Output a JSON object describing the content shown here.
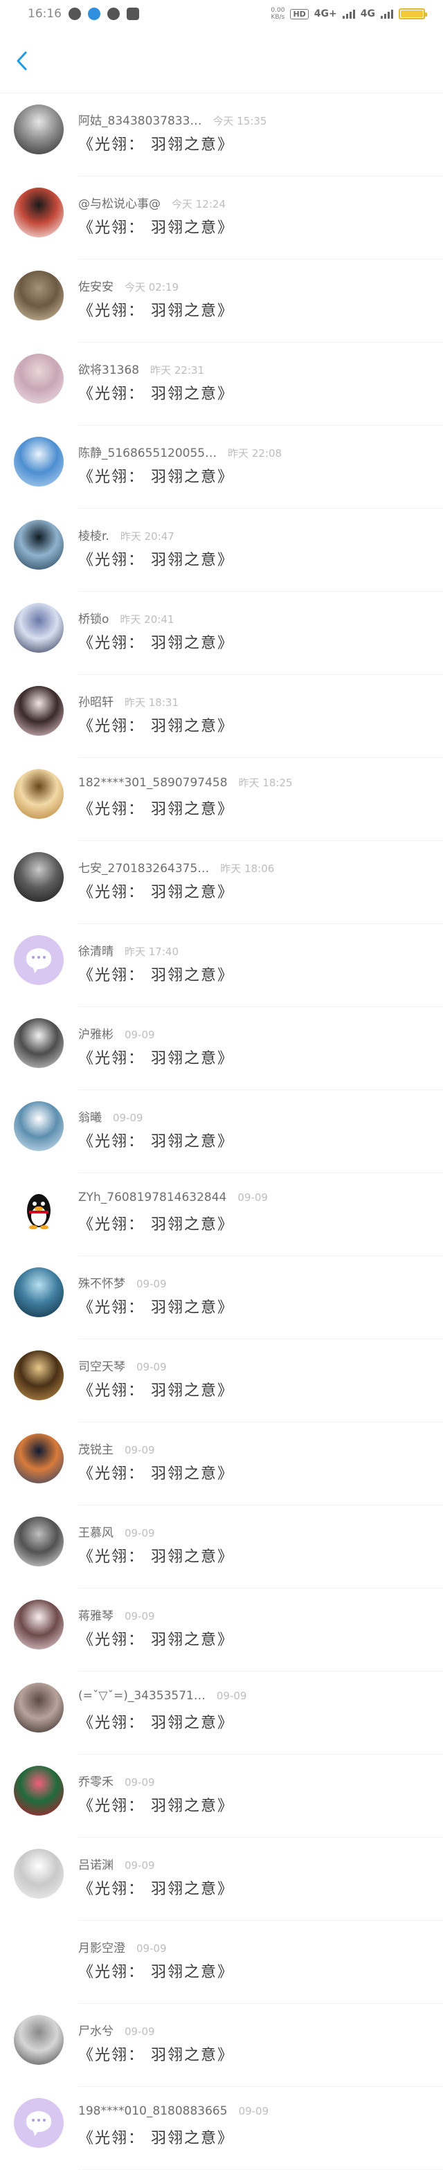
{
  "status_bar": {
    "time": "16:16",
    "speed_value": "0.00",
    "speed_unit": "KB/s",
    "hd_badge": "HD",
    "network_1": "4G+",
    "network_2": "4G"
  },
  "nav": {
    "back_icon": "chevron-left-icon",
    "accent_color": "#1e9be8"
  },
  "rows": [
    {
      "name": "阿姑_83438037833…",
      "time": "今天 15:35",
      "content": "《光翎： 羽翎之意》",
      "avatar_colors": [
        "#2b2b2b",
        "#8c8c8c",
        "#e6e6e6"
      ]
    },
    {
      "name": "@与松说心事@",
      "time": "今天 12:24",
      "content": "《光翎： 羽翎之意》",
      "avatar_colors": [
        "#ffffff",
        "#c44a3a",
        "#1a1a1a"
      ]
    },
    {
      "name": "佐安安",
      "time": "今天 02:19",
      "content": "《光翎： 羽翎之意》",
      "avatar_colors": [
        "#d8c7a8",
        "#6d5a44",
        "#a39376"
      ]
    },
    {
      "name": "欲将31368",
      "time": "昨天 22:31",
      "content": "《光翎： 羽翎之意》",
      "avatar_colors": [
        "#f2e2e8",
        "#c9a7b4",
        "#e8d6da"
      ]
    },
    {
      "name": "陈静_5168655120055…",
      "time": "昨天 22:08",
      "content": "《光翎： 羽翎之意》",
      "avatar_colors": [
        "#bcd9f4",
        "#4d8fd1",
        "#e9f3fb"
      ]
    },
    {
      "name": "棱棱r.",
      "time": "昨天 20:47",
      "content": "《光翎： 羽翎之意》",
      "avatar_colors": [
        "#1d3a50",
        "#8fb2cc",
        "#0e1a24"
      ]
    },
    {
      "name": "桥锁o",
      "time": "昨天 20:41",
      "content": "《光翎： 羽翎之意》",
      "avatar_colors": [
        "#27304f",
        "#d7dff0",
        "#6a78a8"
      ]
    },
    {
      "name": "孙昭轩",
      "time": "昨天 18:31",
      "content": "《光翎： 羽翎之意》",
      "avatar_colors": [
        "#f5d5dc",
        "#3a2a2a",
        "#f0e6e0"
      ]
    },
    {
      "name": "182****301_5890797458",
      "time": "昨天 18:25",
      "content": "《光翎： 羽翎之意》",
      "avatar_colors": [
        "#b07a2e",
        "#f2d9a6",
        "#6b4718"
      ]
    },
    {
      "name": "七安_270183264375…",
      "time": "昨天 18:06",
      "content": "《光翎： 羽翎之意》",
      "avatar_colors": [
        "#141414",
        "#5c5c5c",
        "#c9c9c9"
      ]
    },
    {
      "name": "徐清晴",
      "time": "昨天 17:40",
      "content": "《光翎： 羽翎之意》",
      "avatar_colors": [
        "#d8c7f0",
        "#d8c7f0",
        "#d8c7f0"
      ],
      "default": true
    },
    {
      "name": "沪雅彬",
      "time": "09-09",
      "content": "《光翎： 羽翎之意》",
      "avatar_colors": [
        "#d9d9d9",
        "#4d4d4d",
        "#f0f0f0"
      ]
    },
    {
      "name": "翁曦",
      "time": "09-09",
      "content": "《光翎： 羽翎之意》",
      "avatar_colors": [
        "#dcebf5",
        "#5d8fb0",
        "#ffffff"
      ]
    },
    {
      "name": "ZYh_7608197814632844",
      "time": "09-09",
      "content": "《光翎： 羽翎之意》",
      "avatar_colors": [
        "#ffffff",
        "#111111",
        "#f5a623"
      ],
      "penguin": true
    },
    {
      "name": "殊不怀梦",
      "time": "09-09",
      "content": "《光翎： 羽翎之意》",
      "avatar_colors": [
        "#0e2a3c",
        "#3f7d9e",
        "#b8dff0"
      ]
    },
    {
      "name": "司空天琴",
      "time": "09-09",
      "content": "《光翎： 羽翎之意》",
      "avatar_colors": [
        "#c89a52",
        "#4a3015",
        "#e9c98c"
      ]
    },
    {
      "name": "茂锐主",
      "time": "09-09",
      "content": "《光翎： 羽翎之意》",
      "avatar_colors": [
        "#28406a",
        "#d87b3b",
        "#0f1c33"
      ]
    },
    {
      "name": "王慕风",
      "time": "09-09",
      "content": "《光翎： 羽翎之意》",
      "avatar_colors": [
        "#e7e7e7",
        "#525252",
        "#bfbfbf"
      ]
    },
    {
      "name": "蒋雅琴",
      "time": "09-09",
      "content": "《光翎： 羽翎之意》",
      "avatar_colors": [
        "#f2dfe4",
        "#6f4b4b",
        "#f8eff0"
      ]
    },
    {
      "name": "(=ˇ▽ˇ=)_34353571…",
      "time": "09-09",
      "content": "《光翎： 羽翎之意》",
      "avatar_colors": [
        "#2b2121",
        "#b7a39a",
        "#5c4a44"
      ]
    },
    {
      "name": "乔零禾",
      "time": "09-09",
      "content": "《光翎： 羽翎之意》",
      "avatar_colors": [
        "#c7132f",
        "#1f6b3c",
        "#f06079"
      ]
    },
    {
      "name": "吕诺渊",
      "time": "09-09",
      "content": "《光翎： 羽翎之意》",
      "avatar_colors": [
        "#f3f3f3",
        "#c9c9c9",
        "#ffffff"
      ]
    },
    {
      "name": "月影空澄",
      "time": "09-09",
      "content": "《光翎： 羽翎之意》",
      "avatar_colors": [
        "#ffffff",
        "#ffffff",
        "#ffffff"
      ],
      "blank": true
    },
    {
      "name": "尸水兮",
      "time": "09-09",
      "content": "《光翎： 羽翎之意》",
      "avatar_colors": [
        "#444444",
        "#d6d6d6",
        "#8a8a8a"
      ]
    },
    {
      "name": "198****010_8180883665",
      "time": "09-09",
      "content": "《光翎： 羽翎之意》",
      "avatar_colors": [
        "#d8c7f0",
        "#d8c7f0",
        "#d8c7f0"
      ],
      "default": true
    }
  ]
}
